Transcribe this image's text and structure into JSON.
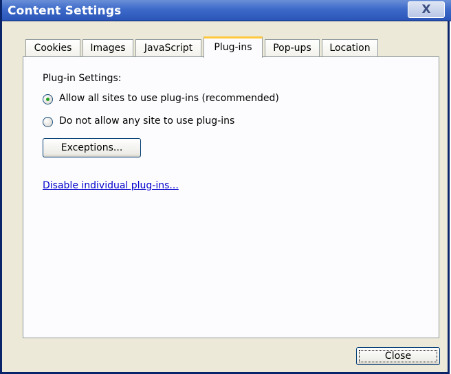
{
  "window": {
    "title": "Content Settings",
    "close_glyph": "X"
  },
  "tabs": [
    {
      "label": "Cookies",
      "active": false
    },
    {
      "label": "Images",
      "active": false
    },
    {
      "label": "JavaScript",
      "active": false
    },
    {
      "label": "Plug-ins",
      "active": true
    },
    {
      "label": "Pop-ups",
      "active": false
    },
    {
      "label": "Location",
      "active": false
    }
  ],
  "plugins": {
    "section_label": "Plug-in Settings:",
    "options": [
      {
        "label": "Allow all sites to use plug-ins (recommended)",
        "selected": true
      },
      {
        "label": "Do not allow any site to use plug-ins",
        "selected": false
      }
    ],
    "exceptions_button": "Exceptions...",
    "disable_link": "Disable individual plug-ins..."
  },
  "footer": {
    "close_button": "Close"
  },
  "colors": {
    "titlebar": "#2a55b8",
    "active_tab_accent": "#ffc83c",
    "radio_dot": "#21a121",
    "link": "#0000cc"
  }
}
